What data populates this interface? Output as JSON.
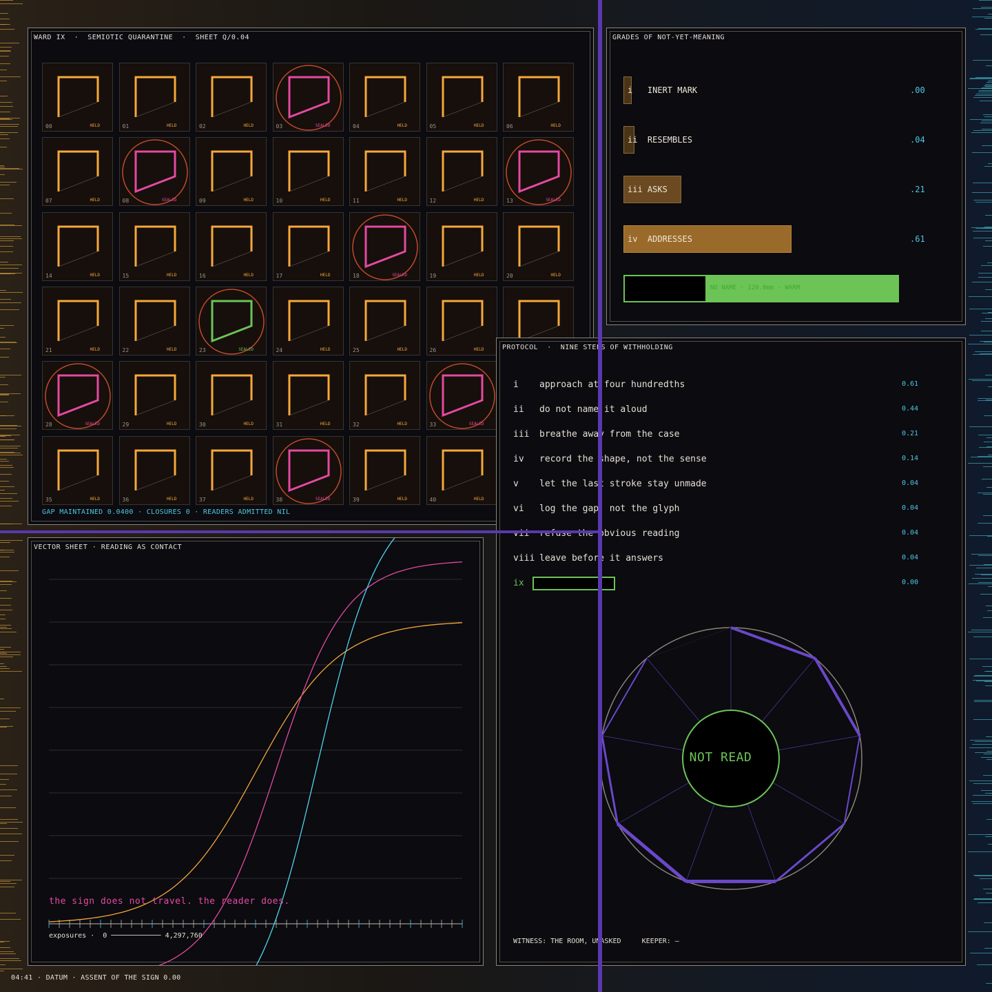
{
  "grid": {
    "title": "WARD IX  ·  SEMIOTIC QUARANTINE  ·  SHEET Q/0.04",
    "held_label": "HELD",
    "sealed_label": "SEALED",
    "sealed_indices": [
      3,
      8,
      13,
      18,
      23,
      28,
      33,
      38
    ],
    "green_index": 23,
    "cell_count": 42,
    "footer": "GAP MAINTAINED 0.0400 · CLOSURES 0 · READERS ADMITTED NIL",
    "colors": {
      "held": "#f6a83a",
      "sealed": "#e44aa0",
      "seal_ring": "#c04a2a",
      "green": "#6cc456"
    }
  },
  "grades": {
    "title": "GRADES OF NOT-YET-MEANING",
    "rows": [
      {
        "label": "i   INERT MARK",
        "value": ".00",
        "fill": 0.0
      },
      {
        "label": "ii  RESEMBLES",
        "value": ".04",
        "fill": 0.04
      },
      {
        "label": "iii ASKS",
        "value": ".21",
        "fill": 0.21
      },
      {
        "label": "iv  ADDRESSES",
        "value": ".61",
        "fill": 0.61
      }
    ],
    "name_bar": "NO NAME · 120.0mm · WARM"
  },
  "vector": {
    "title": "VECTOR SHEET · READING AS CONTACT",
    "caption": "the sign does not travel. the reader does.",
    "axis_label": "exposures ·  0 ──────────── 4,297,760",
    "series": [
      {
        "name": "orange",
        "color": "#f6a83a",
        "start": 0.1,
        "end": 0.65,
        "mid": 0.5,
        "k": 10
      },
      {
        "name": "magenta",
        "color": "#e44aa0",
        "start": 0.0,
        "end": 0.76,
        "mid": 0.55,
        "k": 12
      },
      {
        "name": "cyan",
        "color": "#4fd6ee",
        "start": -0.1,
        "end": 0.88,
        "mid": 0.65,
        "k": 13
      }
    ]
  },
  "protocol": {
    "title": "PROTOCOL  ·  NINE STEPS OF WITHHOLDING",
    "steps": [
      {
        "roman": "i",
        "text": "approach at four hundredths",
        "value": "0.61"
      },
      {
        "roman": "ii",
        "text": "do not name it aloud",
        "value": "0.44"
      },
      {
        "roman": "iii",
        "text": "breathe away from the case",
        "value": "0.21"
      },
      {
        "roman": "iv",
        "text": "record the shape, not the sense",
        "value": "0.14"
      },
      {
        "roman": "v",
        "text": "let the last stroke stay unmade",
        "value": "0.04"
      },
      {
        "roman": "vi",
        "text": "log the gap, not the glyph",
        "value": "0.04"
      },
      {
        "roman": "vii",
        "text": "refuse the obvious reading",
        "value": "0.04"
      },
      {
        "roman": "viii",
        "text": "leave before it answers",
        "value": "0.04"
      }
    ],
    "step_ix": {
      "roman": "ix",
      "value": "0.00"
    },
    "dial_center": "NOT READ",
    "witness": "WITNESS: THE ROOM, UNASKED     KEEPER: —"
  },
  "footer": "04:41 · DATUM · ASSENT OF THE SIGN 0.00"
}
